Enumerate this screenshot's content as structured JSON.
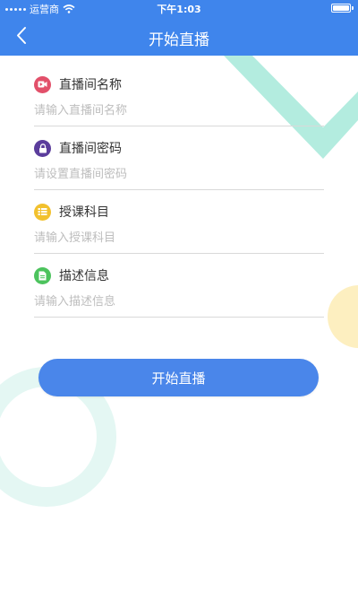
{
  "status_bar": {
    "carrier": "运营商",
    "time": "下午1:03"
  },
  "nav": {
    "title": "开始直播",
    "back_icon": "chevron-left-icon"
  },
  "form": {
    "fields": [
      {
        "label": "直播间名称",
        "placeholder": "请输入直播间名称",
        "value": "",
        "icon": "video-icon",
        "icon_color": "#e2506a"
      },
      {
        "label": "直播间密码",
        "placeholder": "请设置直播间密码",
        "value": "",
        "icon": "lock-icon",
        "icon_color": "#5b3d9c"
      },
      {
        "label": "授课科目",
        "placeholder": "请输入授课科目",
        "value": "",
        "icon": "list-icon",
        "icon_color": "#f2c12e"
      },
      {
        "label": "描述信息",
        "placeholder": "请输入描述信息",
        "value": "",
        "icon": "document-icon",
        "icon_color": "#4cc35d"
      }
    ]
  },
  "start_button": {
    "label": "开始直播"
  },
  "colors": {
    "primary": "#3f85ec",
    "button": "#4a86ea",
    "deco_teal": "#aeeadf",
    "deco_yellow": "#fdeeb8"
  }
}
